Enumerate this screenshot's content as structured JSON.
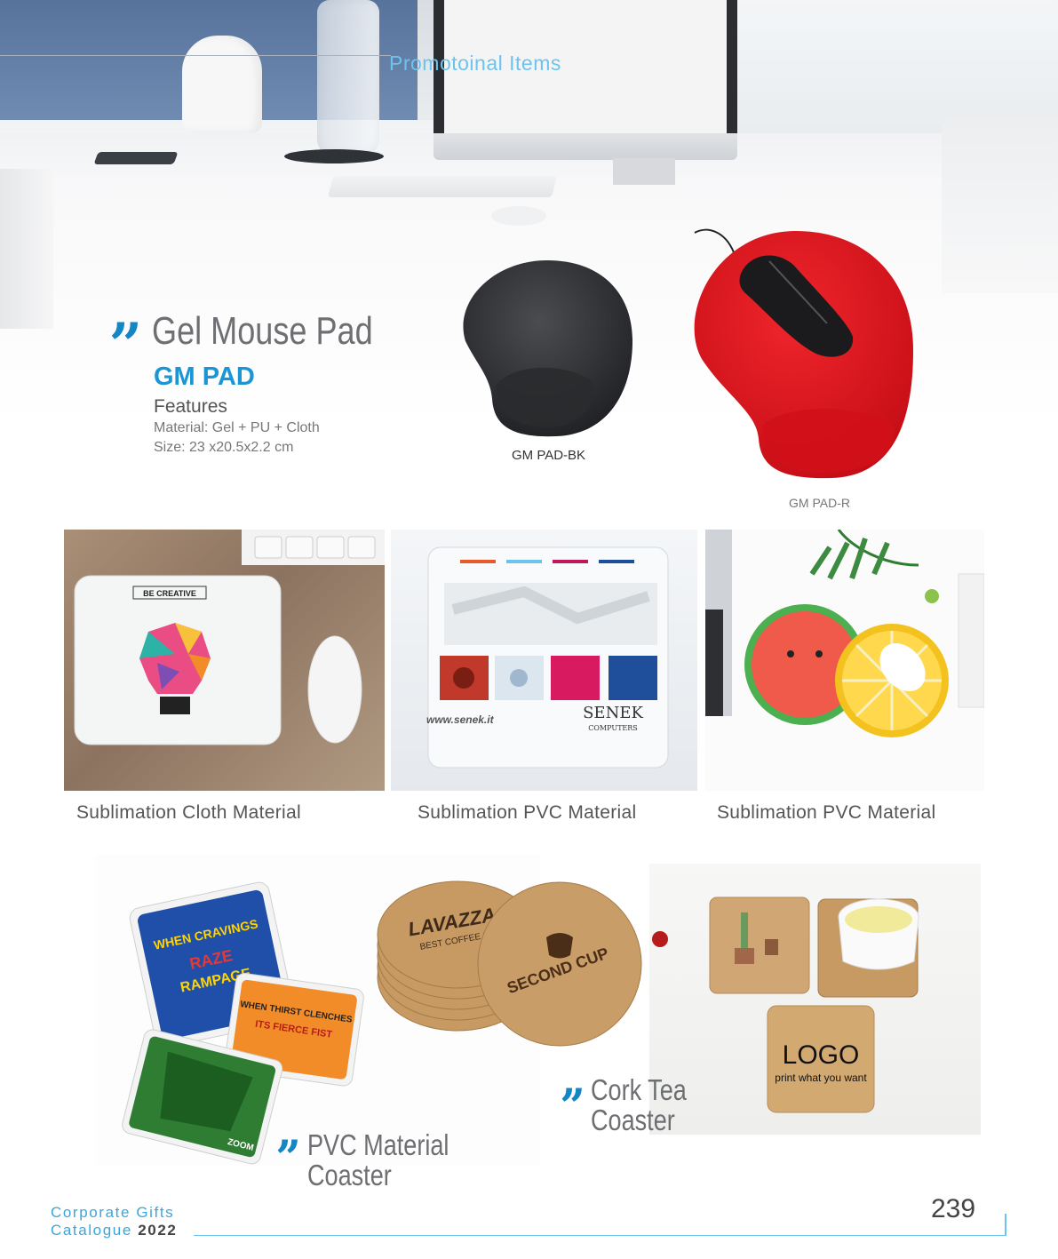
{
  "header": {
    "section_title": "Promotoinal Items"
  },
  "gel_pad": {
    "title": "Gel Mouse Pad",
    "model": "GM PAD",
    "features_heading": "Features",
    "material": "Material: Gel + PU + Cloth",
    "size": "Size: 23 x20.5x2.2 cm",
    "variants": [
      {
        "code": "GM PAD-BK",
        "color": "#2f3033"
      },
      {
        "code": "GM PAD-R",
        "color": "#e3121b"
      }
    ]
  },
  "sublimation": {
    "captions": [
      "Sublimation Cloth Material",
      "Sublimation PVC Material",
      "Sublimation PVC Material"
    ],
    "photo1": {
      "pad_text": "BE CREATIVE"
    },
    "photo2": {
      "url": "www.senek.it",
      "brand": "SENEK",
      "brand_sub": "COMPUTERS"
    }
  },
  "coasters": {
    "pvc_title_line1": "PVC Material",
    "pvc_title_line2": "Coaster",
    "cork_title_line1": "Cork Tea",
    "cork_title_line2": "Coaster",
    "cork_brand1": "LAVAZZA",
    "cork_brand1_sub": "BEST COFFEE S",
    "cork_brand2": "SECOND CUP",
    "logo_text": "LOGO",
    "logo_sub": "print what you want",
    "pvc_art": [
      "WHEN CRAVINGS",
      "RAZE",
      "RAMPAGE",
      "WHEN THIRST CLENCHES",
      "ITS FIERCE FIST",
      "ZOOM"
    ]
  },
  "footer": {
    "catalogue_line1": "Corporate Gifts",
    "catalogue_line2": "Catalogue",
    "year": "2022",
    "page_number": "239"
  },
  "colors": {
    "accent_blue": "#1c95d4",
    "light_blue": "#6cc4ee",
    "grey_heading": "#6e6f73"
  }
}
